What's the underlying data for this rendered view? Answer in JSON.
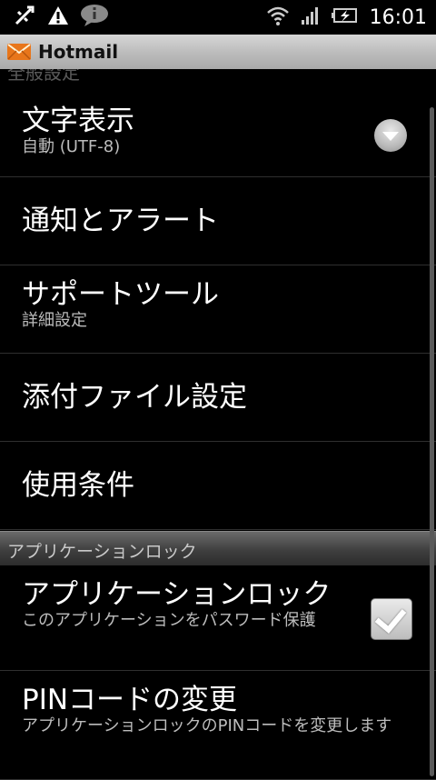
{
  "status_bar": {
    "time": "16:01",
    "icons": [
      "usb-debug-icon",
      "warning-icon",
      "chat-bubble-icon",
      "wifi-icon",
      "signal-icon",
      "battery-charging-icon"
    ]
  },
  "app_bar": {
    "title": "Hotmail",
    "icon": "envelope-icon"
  },
  "ghost_header": "全般設定",
  "items": [
    {
      "title": "文字表示",
      "subtitle": "自動 (UTF-8)"
    },
    {
      "title": "通知とアラート"
    },
    {
      "title": "サポートツール",
      "subtitle": "詳細設定"
    },
    {
      "title": "添付ファイル設定"
    },
    {
      "title": "使用条件"
    }
  ],
  "section_header": "アプリケーションロック",
  "lock_items": [
    {
      "title": "アプリケーションロック",
      "subtitle": "このアプリケーションをパスワード保護",
      "checked": true
    },
    {
      "title": "PINコードの変更",
      "subtitle": "アプリケーションロックのPINコードを変更します"
    }
  ]
}
